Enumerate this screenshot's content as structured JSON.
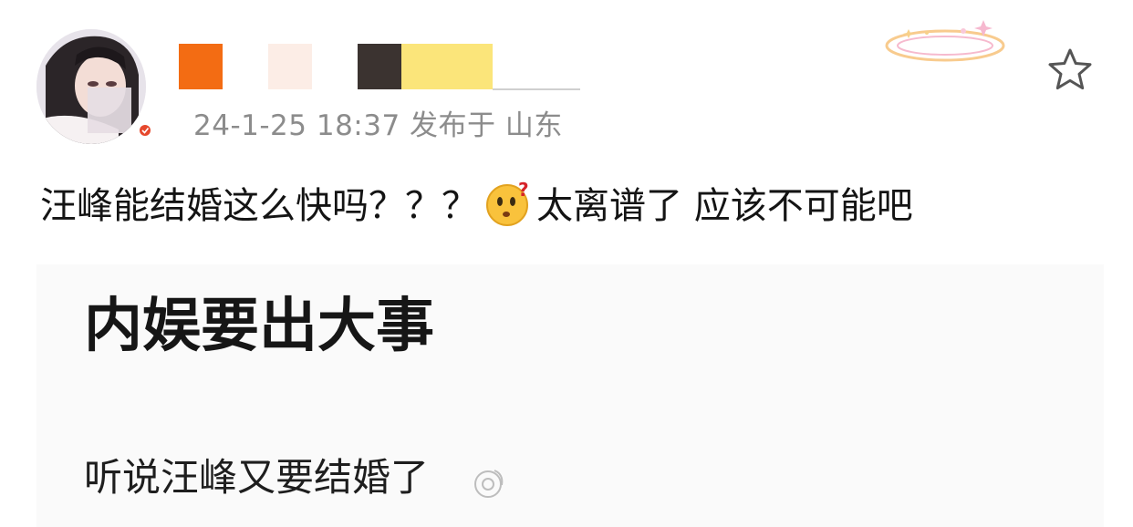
{
  "post": {
    "meta": "24-1-25 18:37  发布于 山东",
    "text_before_emoji": "汪峰能结婚这么快吗？？？",
    "emoji_name": "confused-emoji",
    "text_after_emoji": "太离谱了 应该不可能吧",
    "favorite_icon": "star-icon"
  },
  "user": {
    "avatar_icon": "avatar",
    "name_redaction_colors": [
      "#f36c13",
      "#fcede6",
      "#3b3330",
      "#fbe57a"
    ]
  },
  "attachment": {
    "headline": "内娱要出大事",
    "subline": "听说汪峰又要结婚了"
  },
  "colors": {
    "text": "#141414",
    "meta": "#8c8c8c",
    "background": "#ffffff",
    "attachment_bg": "#fafafa"
  }
}
